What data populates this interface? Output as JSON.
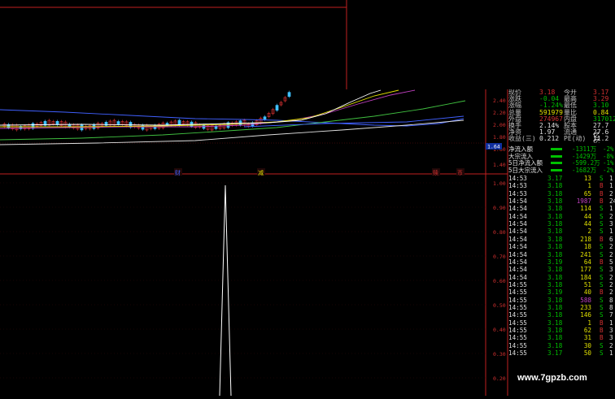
{
  "price_axis": {
    "top_labels": [
      "2.40",
      "2.20",
      "2.00",
      "1.80",
      "1.60"
    ],
    "current_price_marker": "1.64"
  },
  "indicator_axis": {
    "labels": [
      "1.00",
      "0.90",
      "0.80",
      "0.70",
      "0.60",
      "0.50",
      "0.40",
      "0.30",
      "0.20"
    ]
  },
  "event_markers": [
    "财",
    "减",
    "赎",
    "币"
  ],
  "indicator_spike_value": 1.0,
  "quote_panel": {
    "rows": [
      {
        "l1": "现价",
        "v1": "3.18",
        "l2": "今开",
        "v2": "3.17",
        "c1": "#d03030",
        "c2": "#d03030"
      },
      {
        "l1": "涨跌",
        "v1": "-0.04",
        "l2": "最高",
        "v2": "3.29",
        "c1": "#00c000",
        "c2": "#d03030"
      },
      {
        "l1": "涨幅",
        "v1": "-1.24%",
        "l2": "最低",
        "v2": "3.10",
        "c1": "#00c000",
        "c2": "#00c000"
      },
      {
        "l1": "总量",
        "v1": "591979",
        "l2": "量比",
        "v2": "0.84",
        "c1": "#e0e000",
        "c2": "#e0e000"
      },
      {
        "l1": "外盘",
        "v1": "274967",
        "l2": "内盘",
        "v2": "317012",
        "c1": "#d03030",
        "c2": "#00c000"
      },
      {
        "l1": "换手",
        "v1": "2.14%",
        "l2": "股本",
        "v2": "27.7亿",
        "c1": "#e0e0e0",
        "c2": "#e0e0e0"
      },
      {
        "l1": "净资",
        "v1": "1.97",
        "l2": "流通",
        "v2": "27.6亿",
        "c1": "#e0e0e0",
        "c2": "#e0e0e0"
      },
      {
        "l1": "收益(三)",
        "v1": "0.212",
        "l2": "PE(动)",
        "v2": "11.2",
        "c1": "#e0e0e0",
        "c2": "#e0e0e0"
      }
    ]
  },
  "flow_panel": {
    "rows": [
      {
        "label": "净流入额",
        "value": "-1311万",
        "pct": "-2%"
      },
      {
        "label": "大宗流入",
        "value": "-1429万",
        "pct": "-8%"
      },
      {
        "label": "5日净流入额",
        "value": "-599.2万",
        "pct": "-1%"
      },
      {
        "label": "5日大宗流入",
        "value": "-1682万",
        "pct": "-2%"
      }
    ]
  },
  "trades": [
    {
      "time": "14:53",
      "price": "3.17",
      "vol": "13",
      "side": "S",
      "n": "1",
      "pc": "#00c000",
      "vc": "#e0e000"
    },
    {
      "time": "14:53",
      "price": "3.18",
      "vol": "1",
      "side": "B",
      "n": "1",
      "pc": "#00c000",
      "vc": "#e0e000"
    },
    {
      "time": "14:53",
      "price": "3.18",
      "vol": "65",
      "side": "B",
      "n": "2",
      "pc": "#00c000",
      "vc": "#e0e000"
    },
    {
      "time": "14:54",
      "price": "3.18",
      "vol": "1987",
      "side": "B",
      "n": "24",
      "pc": "#00c000",
      "vc": "#c040c0"
    },
    {
      "time": "14:54",
      "price": "3.18",
      "vol": "114",
      "side": "S",
      "n": "1",
      "pc": "#00c000",
      "vc": "#e0e000"
    },
    {
      "time": "14:54",
      "price": "3.18",
      "vol": "44",
      "side": "S",
      "n": "2",
      "pc": "#00c000",
      "vc": "#e0e000"
    },
    {
      "time": "14:54",
      "price": "3.18",
      "vol": "44",
      "side": "S",
      "n": "3",
      "pc": "#00c000",
      "vc": "#e0e000"
    },
    {
      "time": "14:54",
      "price": "3.18",
      "vol": "2",
      "side": "S",
      "n": "1",
      "pc": "#00c000",
      "vc": "#e0e000"
    },
    {
      "time": "14:54",
      "price": "3.18",
      "vol": "218",
      "side": "B",
      "n": "6",
      "pc": "#00c000",
      "vc": "#e0e000"
    },
    {
      "time": "14:54",
      "price": "3.18",
      "vol": "18",
      "side": "S",
      "n": "2",
      "pc": "#00c000",
      "vc": "#e0e000"
    },
    {
      "time": "14:54",
      "price": "3.18",
      "vol": "241",
      "side": "S",
      "n": "2",
      "pc": "#00c000",
      "vc": "#e0e000"
    },
    {
      "time": "14:54",
      "price": "3.19",
      "vol": "64",
      "side": "B",
      "n": "5",
      "pc": "#00c000",
      "vc": "#e0e000"
    },
    {
      "time": "14:54",
      "price": "3.18",
      "vol": "177",
      "side": "S",
      "n": "3",
      "pc": "#00c000",
      "vc": "#e0e000"
    },
    {
      "time": "14:54",
      "price": "3.18",
      "vol": "184",
      "side": "S",
      "n": "2",
      "pc": "#00c000",
      "vc": "#e0e000"
    },
    {
      "time": "14:55",
      "price": "3.18",
      "vol": "51",
      "side": "S",
      "n": "2",
      "pc": "#00c000",
      "vc": "#e0e000"
    },
    {
      "time": "14:55",
      "price": "3.19",
      "vol": "40",
      "side": "B",
      "n": "2",
      "pc": "#00c000",
      "vc": "#e0e000"
    },
    {
      "time": "14:55",
      "price": "3.18",
      "vol": "588",
      "side": "S",
      "n": "8",
      "pc": "#00c000",
      "vc": "#c040c0"
    },
    {
      "time": "14:55",
      "price": "3.18",
      "vol": "233",
      "side": "S",
      "n": "8",
      "pc": "#00c000",
      "vc": "#e0e000"
    },
    {
      "time": "14:55",
      "price": "3.18",
      "vol": "146",
      "side": "S",
      "n": "7",
      "pc": "#00c000",
      "vc": "#e0e000"
    },
    {
      "time": "14:55",
      "price": "3.18",
      "vol": "1",
      "side": "B",
      "n": "1",
      "pc": "#00c000",
      "vc": "#e0e000"
    },
    {
      "time": "14:55",
      "price": "3.18",
      "vol": "62",
      "side": "B",
      "n": "3",
      "pc": "#00c000",
      "vc": "#e0e000"
    },
    {
      "time": "14:55",
      "price": "3.18",
      "vol": "31",
      "side": "B",
      "n": "3",
      "pc": "#00c000",
      "vc": "#e0e000"
    },
    {
      "time": "14:55",
      "price": "3.18",
      "vol": "30",
      "side": "S",
      "n": "2",
      "pc": "#00c000",
      "vc": "#e0e000"
    },
    {
      "time": "14:55",
      "price": "3.17",
      "vol": "50",
      "side": "S",
      "n": "1",
      "pc": "#00c000",
      "vc": "#e0e000"
    }
  ],
  "watermark": "www.7gpzb.com",
  "colors": {
    "up": "#d03030",
    "down": "#00c000",
    "grid": "#b02020",
    "ma5": "#ffffff",
    "ma10": "#e0e000",
    "ma20": "#c040c0",
    "ma30": "#40c040",
    "ma60": "#4060ff"
  }
}
